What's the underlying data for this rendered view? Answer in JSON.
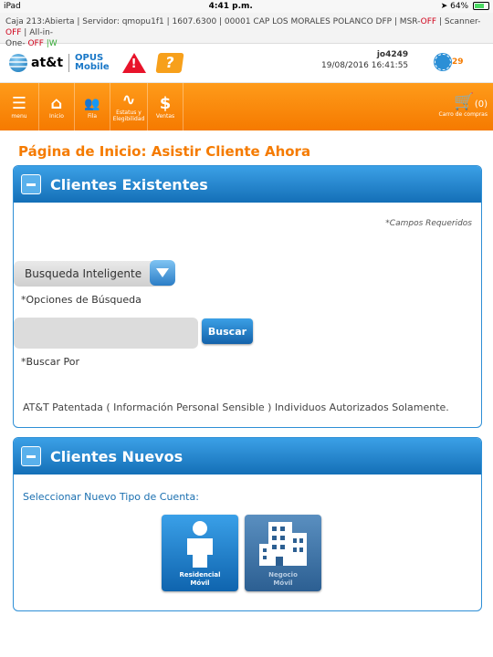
{
  "status_bar": {
    "device": "iPad",
    "time": "4:41 p.m.",
    "battery": "64%"
  },
  "info_bar": {
    "line1_a": "Caja 213:Abierta  |  Servidor: qmopu1f1  |  1607.6300  |  00001 CAP LOS MORALES POLANCO DFP  |  MSR-",
    "msr_state": "OFF",
    "scanner_label": "  |  Scanner-",
    "scanner_state": "OFF",
    "allin_label": "  |  All-in-",
    "line2_a": "One- ",
    "allin_state": "OFF",
    "w_label": "|W"
  },
  "header": {
    "att_label": "at&t",
    "opus_line1": "OPUS",
    "opus_line2": "Mobile",
    "help_glyph": "?",
    "warn_glyph": "!",
    "user": "jo4249",
    "datetime": "19/08/2016 16:41:55",
    "notifications": "29"
  },
  "nav": [
    {
      "label": "menu",
      "icon": "☰"
    },
    {
      "label": "Inicio",
      "icon": "⌂"
    },
    {
      "label": "Fila",
      "icon": "👥"
    },
    {
      "label": "Estatus y Elegibilidad",
      "icon": "∿"
    },
    {
      "label": "Ventas",
      "icon": "$"
    }
  ],
  "cart": {
    "count": "(0)",
    "label": "Carro de compras"
  },
  "page_title": "Página de Inicio: Asistir Cliente Ahora",
  "existing": {
    "title": "Clientes Existentes",
    "required_note": "*Campos Requeridos",
    "search_type": "Busqueda Inteligente",
    "search_options_label": "*Opciones de Búsqueda",
    "search_value": "",
    "search_button": "Buscar",
    "search_by_label": "*Buscar Por",
    "legal": "AT&T Patentada ( Información Personal Sensible ) Individuos Autorizados Solamente."
  },
  "new_clients": {
    "title": "Clientes Nuevos",
    "select_label": "Seleccionar Nuevo Tipo de Cuenta:",
    "tiles": [
      {
        "line1": "Residencial",
        "line2": "Móvil"
      },
      {
        "line1": "Negocio",
        "line2": "Móvil"
      }
    ]
  }
}
